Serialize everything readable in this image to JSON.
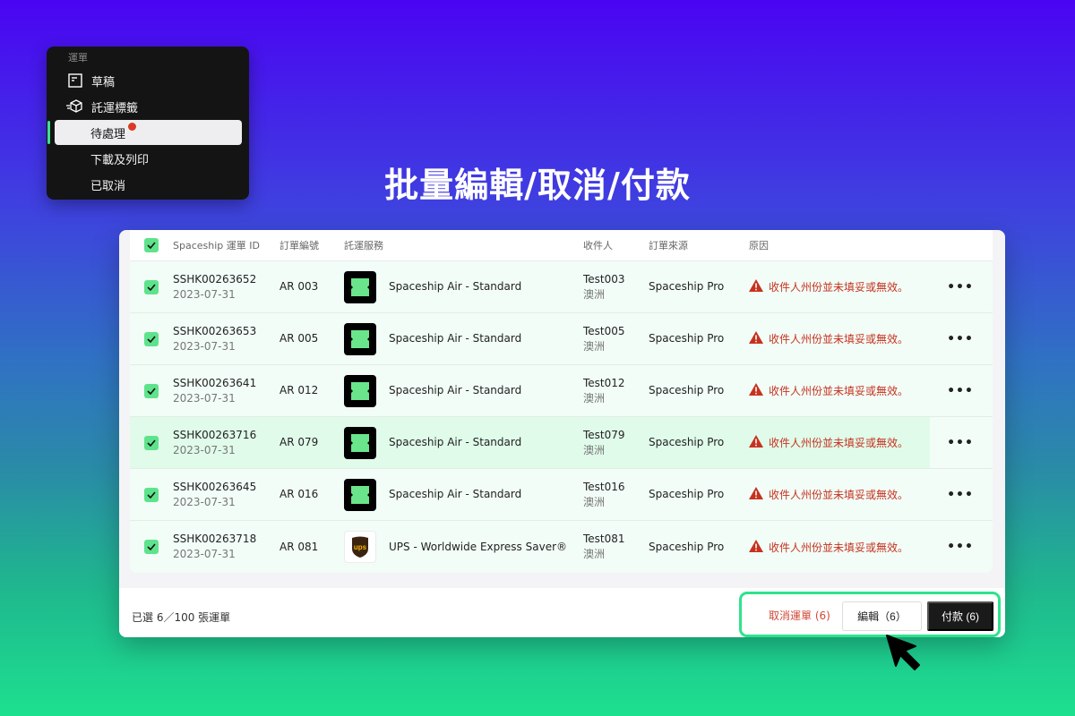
{
  "menu": {
    "section_label": "運單",
    "items": [
      {
        "label": "草稿",
        "icon": "draft-icon"
      },
      {
        "label": "託運標籤",
        "icon": "package-icon"
      },
      {
        "label": "待處理",
        "active": true,
        "badge": "red-dot"
      },
      {
        "label": "下載及列印"
      },
      {
        "label": "已取消"
      }
    ]
  },
  "headline": "批量編輯/取消/付款",
  "table": {
    "columns": [
      "Spaceship 運單 ID",
      "訂單編號",
      "託運服務",
      "收件人",
      "訂單來源",
      "原因"
    ],
    "rows": [
      {
        "id": "SSHK00263652",
        "date": "2023-07-31",
        "order": "AR 003",
        "service": "Spaceship Air - Standard",
        "logo": "spaceship",
        "recipient": "Test003",
        "region": "澳洲",
        "source": "Spaceship Pro",
        "reason": "收件人州份並未填妥或無效。",
        "checked": true
      },
      {
        "id": "SSHK00263653",
        "date": "2023-07-31",
        "order": "AR 005",
        "service": "Spaceship Air - Standard",
        "logo": "spaceship",
        "recipient": "Test005",
        "region": "澳洲",
        "source": "Spaceship Pro",
        "reason": "收件人州份並未填妥或無效。",
        "checked": true
      },
      {
        "id": "SSHK00263641",
        "date": "2023-07-31",
        "order": "AR 012",
        "service": "Spaceship Air - Standard",
        "logo": "spaceship",
        "recipient": "Test012",
        "region": "澳洲",
        "source": "Spaceship Pro",
        "reason": "收件人州份並未填妥或無效。",
        "checked": true
      },
      {
        "id": "SSHK00263716",
        "date": "2023-07-31",
        "order": "AR 079",
        "service": "Spaceship Air - Standard",
        "logo": "spaceship",
        "recipient": "Test079",
        "region": "澳洲",
        "source": "Spaceship Pro",
        "reason": "收件人州份並未填妥或無效。",
        "checked": true,
        "hover": true
      },
      {
        "id": "SSHK00263645",
        "date": "2023-07-31",
        "order": "AR 016",
        "service": "Spaceship Air - Standard",
        "logo": "spaceship",
        "recipient": "Test016",
        "region": "澳洲",
        "source": "Spaceship Pro",
        "reason": "收件人州份並未填妥或無效。",
        "checked": true
      },
      {
        "id": "SSHK00263718",
        "date": "2023-07-31",
        "order": "AR 081",
        "service": "UPS - Worldwide Express Saver®",
        "logo": "ups",
        "recipient": "Test081",
        "region": "澳洲",
        "source": "Spaceship Pro",
        "reason": "收件人州份並未填妥或無效。",
        "checked": true
      }
    ],
    "more_label": "•••"
  },
  "footer": {
    "selection_text": "已選 6／100 張運單",
    "cancel_label": "取消運單 (6)",
    "edit_label": "編輯（6）",
    "pay_label": "付款 (6)"
  },
  "colors": {
    "accent_green": "#2de38c",
    "checkbox_green": "#5ee38c",
    "error_red": "#c7321f",
    "dark": "#1a1a1a"
  }
}
